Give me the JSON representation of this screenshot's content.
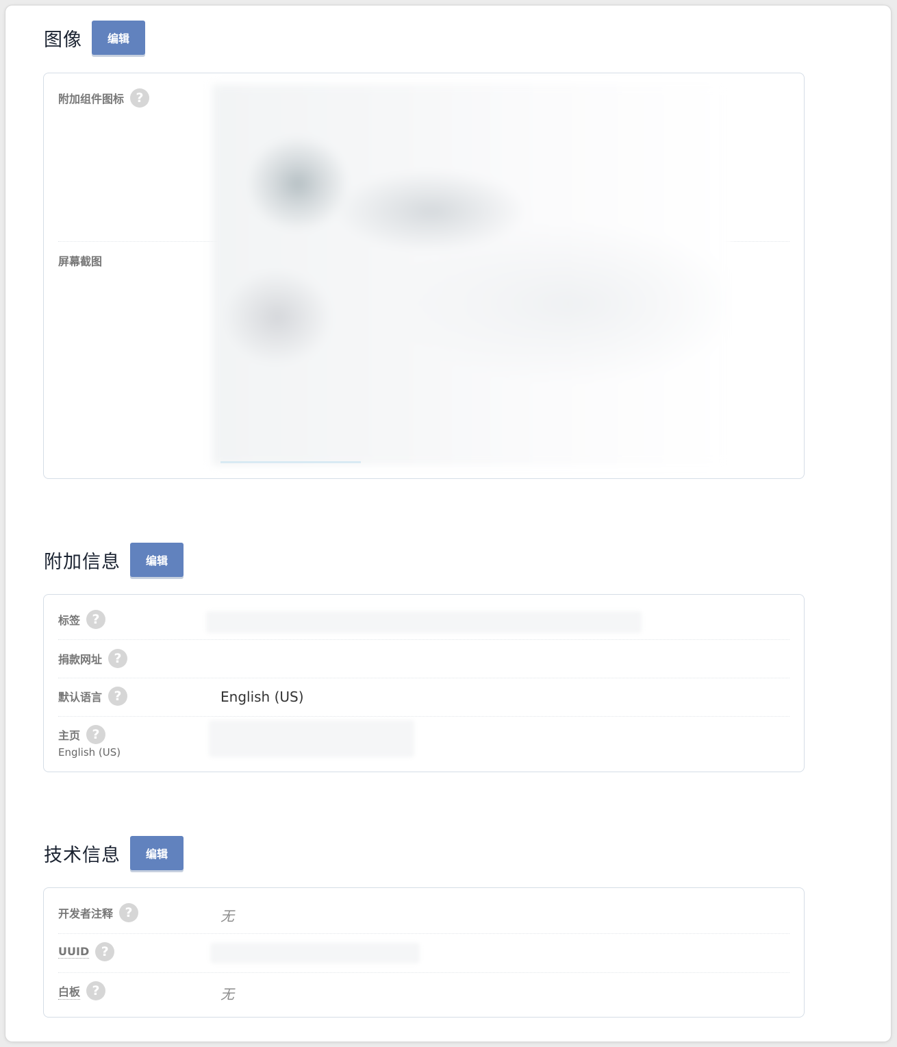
{
  "sections": {
    "images": {
      "title": "图像",
      "edit_label": "编辑",
      "fields": {
        "addon_icon": {
          "label": "附加组件图标",
          "help": "?"
        },
        "screenshots": {
          "label": "屏幕截图"
        }
      }
    },
    "additional": {
      "title": "附加信息",
      "edit_label": "编辑",
      "fields": {
        "tags": {
          "label": "标签",
          "help": "?"
        },
        "contributions_url": {
          "label": "捐款网址",
          "help": "?"
        },
        "default_locale": {
          "label": "默认语言",
          "help": "?",
          "value": "English (US)"
        },
        "homepage": {
          "label": "主页",
          "help": "?",
          "sub_label": "English (US)"
        }
      }
    },
    "technical": {
      "title": "技术信息",
      "edit_label": "编辑",
      "fields": {
        "developer_comments": {
          "label": "开发者注释",
          "help": "?",
          "value": "无"
        },
        "uuid": {
          "label": "UUID",
          "help": "?"
        },
        "whiteboard": {
          "label": "白板",
          "help": "?",
          "value": "无"
        }
      }
    }
  }
}
